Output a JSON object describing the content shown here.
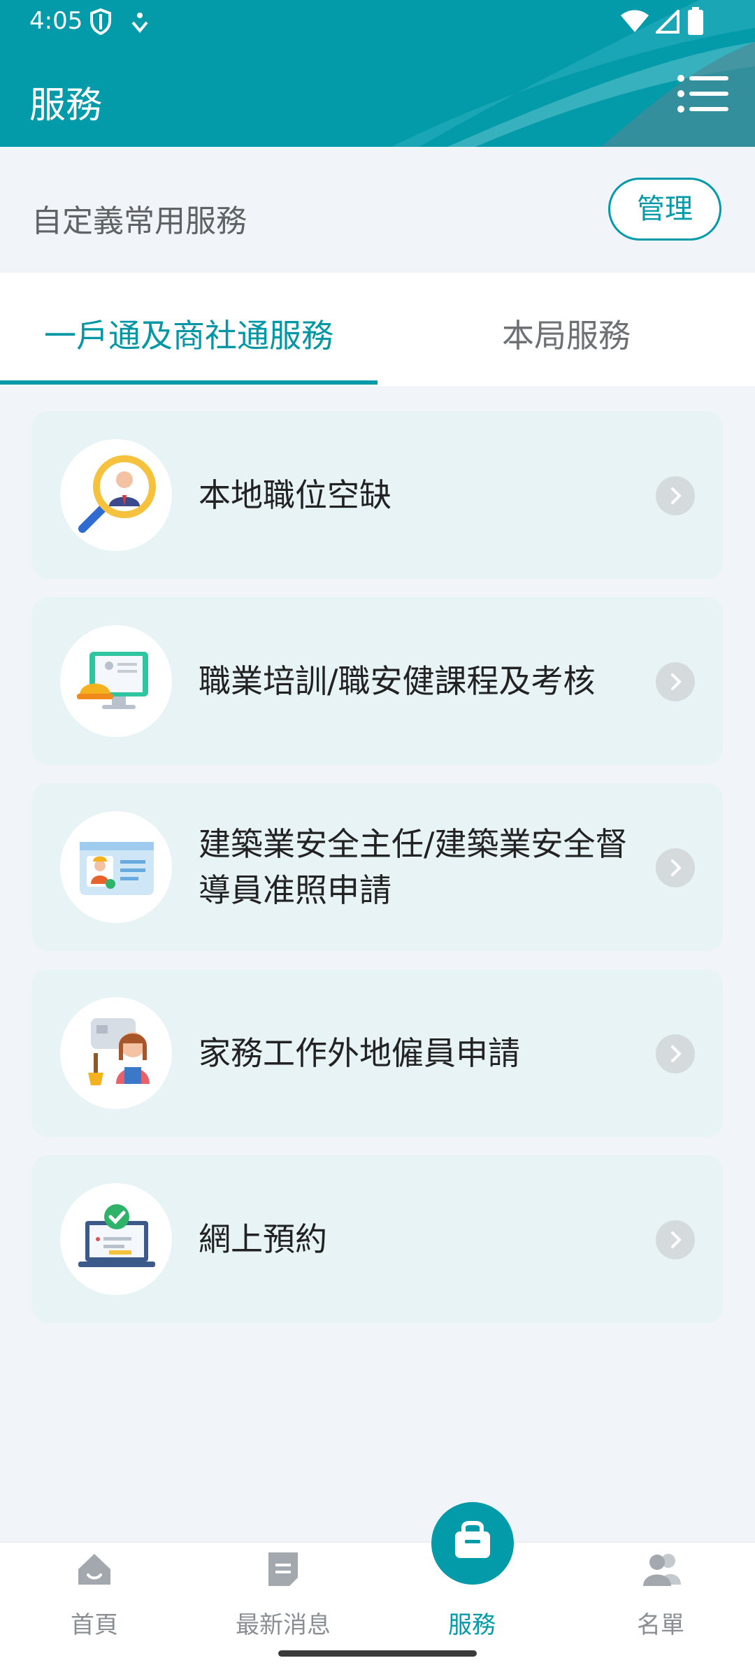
{
  "status_bar": {
    "time": "4:05"
  },
  "header": {
    "title": "服務"
  },
  "custom_services": {
    "label": "自定義常用服務",
    "manage_button": "管理"
  },
  "tabs": [
    {
      "label": "一戶通及商社通服務",
      "active": true
    },
    {
      "label": "本局服務",
      "active": false
    }
  ],
  "services": [
    {
      "label": "本地職位空缺",
      "icon": "job-search-icon"
    },
    {
      "label": "職業培訓/職安健課程及考核",
      "icon": "training-icon"
    },
    {
      "label": "建築業安全主任/建築業安全督導員准照申請",
      "icon": "license-card-icon"
    },
    {
      "label": "家務工作外地僱員申請",
      "icon": "domestic-worker-icon"
    },
    {
      "label": "網上預約",
      "icon": "online-booking-icon"
    }
  ],
  "bottom_nav": [
    {
      "label": "首頁",
      "icon": "home-icon",
      "active": false
    },
    {
      "label": "最新消息",
      "icon": "news-icon",
      "active": false
    },
    {
      "label": "服務",
      "icon": "briefcase-icon",
      "active": true
    },
    {
      "label": "名單",
      "icon": "people-icon",
      "active": false
    }
  ],
  "colors": {
    "primary": "#039aa9",
    "card_bg": "#e8f3f6",
    "page_bg": "#f1f4f8"
  }
}
